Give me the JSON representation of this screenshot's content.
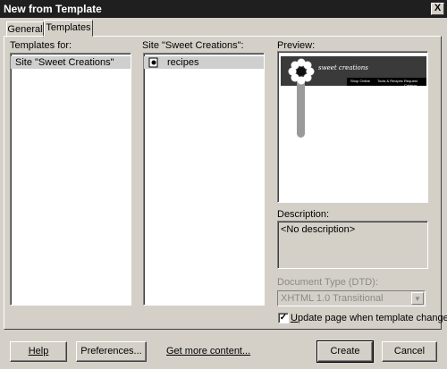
{
  "window": {
    "title": "New from Template",
    "close_glyph": "X"
  },
  "tabs": [
    {
      "label": "General"
    },
    {
      "label": "Templates"
    }
  ],
  "templates_for": {
    "label": "Templates for:",
    "items": [
      {
        "label": "Site \"Sweet Creations\"",
        "selected": true
      }
    ]
  },
  "site_list": {
    "label": "Site \"Sweet Creations\":",
    "items": [
      {
        "label": "recipes",
        "icon": "template-file-icon",
        "selected": true
      }
    ]
  },
  "preview": {
    "label": "Preview:",
    "logo_text": "sweet creations",
    "nav": [
      "Shop Online",
      "Tools & Recipes",
      "Request Catalog"
    ]
  },
  "description": {
    "label": "Description:",
    "value": "<No description>"
  },
  "doctype": {
    "label": "Document Type (DTD):",
    "value": "XHTML 1.0 Transitional"
  },
  "update_checkbox": {
    "checked": true,
    "label": "Update page when template changes"
  },
  "footer": {
    "help_label": "Help",
    "preferences_label": "Preferences...",
    "more_content_label": "Get more content...",
    "create_label": "Create",
    "cancel_label": "Cancel"
  }
}
